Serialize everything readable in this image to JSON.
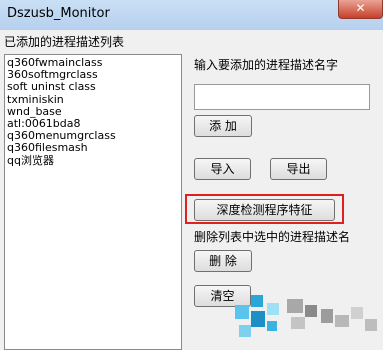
{
  "window": {
    "title": "Dszusb_Monitor",
    "close_label": "✕"
  },
  "list": {
    "heading": "已添加的进程描述列表",
    "items": [
      "q360fwmainclass",
      "360softmgrclass",
      "soft uninst class",
      "txminiskin",
      "wnd_base",
      "atl:0061bda8",
      "q360menumgrclass",
      "q360filesmash",
      "qq浏览器"
    ]
  },
  "add_section": {
    "prompt": "输入要添加的进程描述名字",
    "input_value": "",
    "add_label": "添 加"
  },
  "io": {
    "import_label": "导入",
    "export_label": "导出"
  },
  "deep_detect_label": "深度检测程序特征",
  "delete_section": {
    "prompt": "删除列表中选中的进程描述名",
    "delete_label": "删 除"
  },
  "clear_label": "清空",
  "colors": {
    "titlebar": "#b9d3ef",
    "close_button": "#c7402a",
    "highlight": "#e02020",
    "watermark": "#2aa6d8"
  }
}
